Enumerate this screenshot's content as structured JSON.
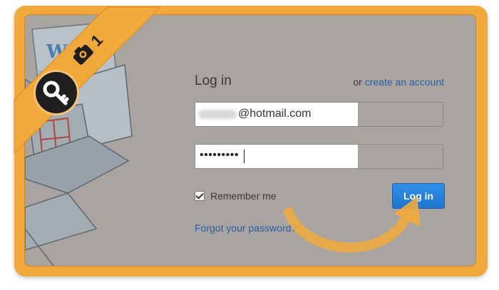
{
  "login": {
    "title": "Log in",
    "or_text": "or",
    "create_account": "create an account",
    "email_value": "@hotmail.com",
    "password_value": "•••••••••",
    "remember_me": "Remember me",
    "login_button": "Log in",
    "forgot_password": "Forgot your password?"
  },
  "banner": {
    "step_number": "1"
  },
  "colors": {
    "frame": "#f0a93a",
    "panel_bg": "#a9a4a0",
    "link": "#2a5fa8",
    "button": "#1e76cf"
  },
  "icons": [
    "key-icon",
    "camera-icon",
    "checkbox-checked-icon",
    "curved-arrow-icon"
  ]
}
